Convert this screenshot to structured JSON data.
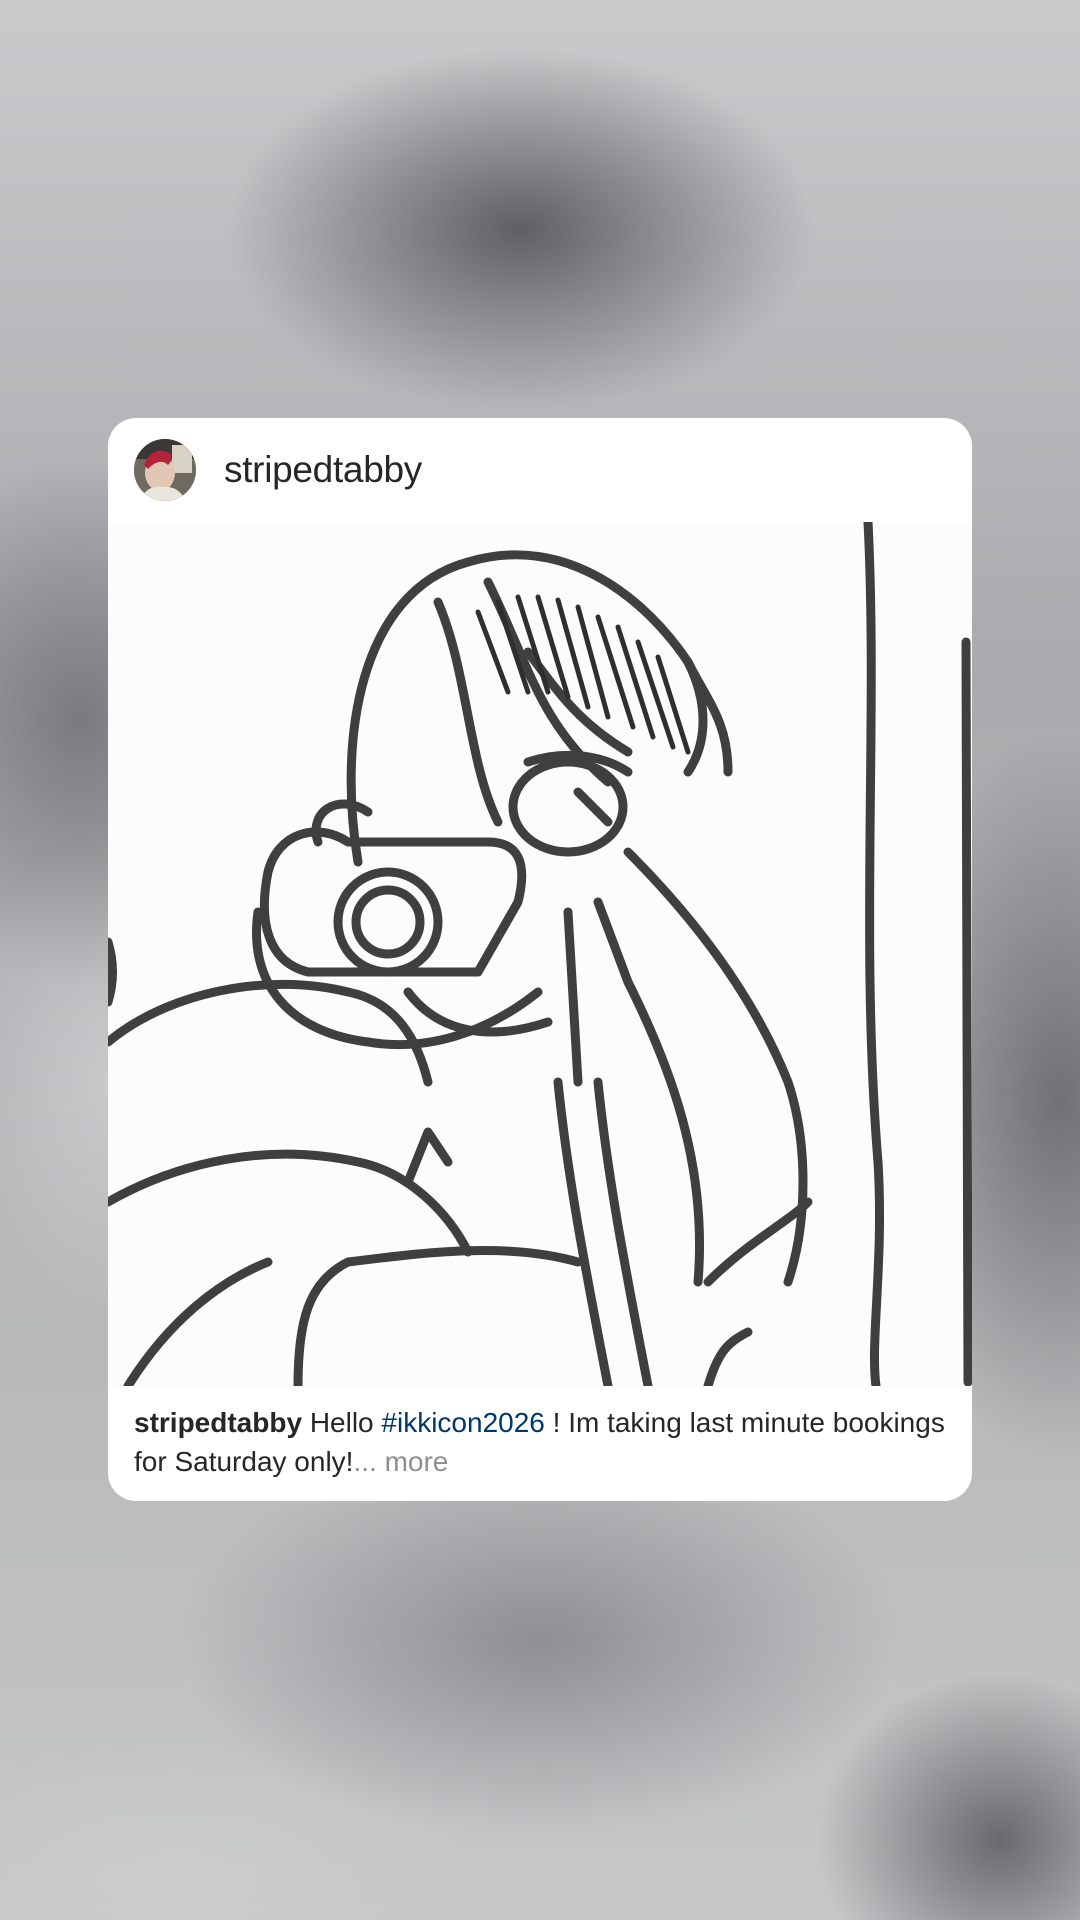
{
  "post": {
    "username": "stripedtabby",
    "caption": {
      "username": "stripedtabby",
      "text_before": "Hello ",
      "hashtag": "#ikkicon2026",
      "text_after": " ! Im taking last minute bookings for Saturday only!",
      "ellipsis": "...",
      "more_label": " more"
    }
  },
  "colors": {
    "hashtag": "#00376b",
    "more": "#8e8e8e",
    "text": "#262626"
  },
  "icons": {
    "avatar": "profile-photo"
  }
}
